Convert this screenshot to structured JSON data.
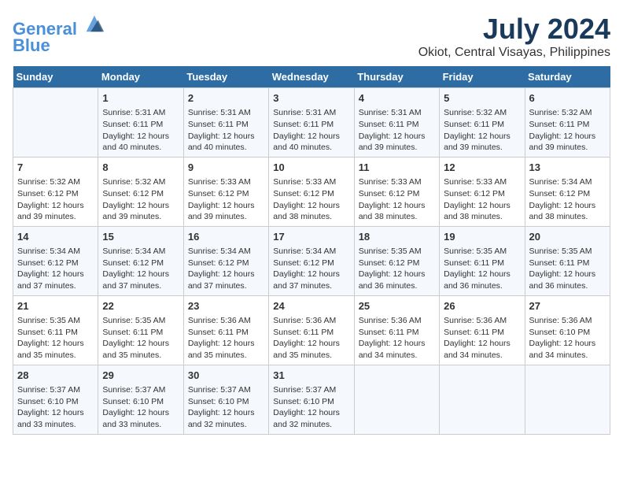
{
  "header": {
    "logo_line1": "General",
    "logo_line2": "Blue",
    "title": "July 2024",
    "subtitle": "Okiot, Central Visayas, Philippines"
  },
  "calendar": {
    "days_of_week": [
      "Sunday",
      "Monday",
      "Tuesday",
      "Wednesday",
      "Thursday",
      "Friday",
      "Saturday"
    ],
    "weeks": [
      [
        {
          "day": "",
          "info": ""
        },
        {
          "day": "1",
          "info": "Sunrise: 5:31 AM\nSunset: 6:11 PM\nDaylight: 12 hours\nand 40 minutes."
        },
        {
          "day": "2",
          "info": "Sunrise: 5:31 AM\nSunset: 6:11 PM\nDaylight: 12 hours\nand 40 minutes."
        },
        {
          "day": "3",
          "info": "Sunrise: 5:31 AM\nSunset: 6:11 PM\nDaylight: 12 hours\nand 40 minutes."
        },
        {
          "day": "4",
          "info": "Sunrise: 5:31 AM\nSunset: 6:11 PM\nDaylight: 12 hours\nand 39 minutes."
        },
        {
          "day": "5",
          "info": "Sunrise: 5:32 AM\nSunset: 6:11 PM\nDaylight: 12 hours\nand 39 minutes."
        },
        {
          "day": "6",
          "info": "Sunrise: 5:32 AM\nSunset: 6:11 PM\nDaylight: 12 hours\nand 39 minutes."
        }
      ],
      [
        {
          "day": "7",
          "info": "Sunrise: 5:32 AM\nSunset: 6:12 PM\nDaylight: 12 hours\nand 39 minutes."
        },
        {
          "day": "8",
          "info": "Sunrise: 5:32 AM\nSunset: 6:12 PM\nDaylight: 12 hours\nand 39 minutes."
        },
        {
          "day": "9",
          "info": "Sunrise: 5:33 AM\nSunset: 6:12 PM\nDaylight: 12 hours\nand 39 minutes."
        },
        {
          "day": "10",
          "info": "Sunrise: 5:33 AM\nSunset: 6:12 PM\nDaylight: 12 hours\nand 38 minutes."
        },
        {
          "day": "11",
          "info": "Sunrise: 5:33 AM\nSunset: 6:12 PM\nDaylight: 12 hours\nand 38 minutes."
        },
        {
          "day": "12",
          "info": "Sunrise: 5:33 AM\nSunset: 6:12 PM\nDaylight: 12 hours\nand 38 minutes."
        },
        {
          "day": "13",
          "info": "Sunrise: 5:34 AM\nSunset: 6:12 PM\nDaylight: 12 hours\nand 38 minutes."
        }
      ],
      [
        {
          "day": "14",
          "info": "Sunrise: 5:34 AM\nSunset: 6:12 PM\nDaylight: 12 hours\nand 37 minutes."
        },
        {
          "day": "15",
          "info": "Sunrise: 5:34 AM\nSunset: 6:12 PM\nDaylight: 12 hours\nand 37 minutes."
        },
        {
          "day": "16",
          "info": "Sunrise: 5:34 AM\nSunset: 6:12 PM\nDaylight: 12 hours\nand 37 minutes."
        },
        {
          "day": "17",
          "info": "Sunrise: 5:34 AM\nSunset: 6:12 PM\nDaylight: 12 hours\nand 37 minutes."
        },
        {
          "day": "18",
          "info": "Sunrise: 5:35 AM\nSunset: 6:12 PM\nDaylight: 12 hours\nand 36 minutes."
        },
        {
          "day": "19",
          "info": "Sunrise: 5:35 AM\nSunset: 6:11 PM\nDaylight: 12 hours\nand 36 minutes."
        },
        {
          "day": "20",
          "info": "Sunrise: 5:35 AM\nSunset: 6:11 PM\nDaylight: 12 hours\nand 36 minutes."
        }
      ],
      [
        {
          "day": "21",
          "info": "Sunrise: 5:35 AM\nSunset: 6:11 PM\nDaylight: 12 hours\nand 35 minutes."
        },
        {
          "day": "22",
          "info": "Sunrise: 5:35 AM\nSunset: 6:11 PM\nDaylight: 12 hours\nand 35 minutes."
        },
        {
          "day": "23",
          "info": "Sunrise: 5:36 AM\nSunset: 6:11 PM\nDaylight: 12 hours\nand 35 minutes."
        },
        {
          "day": "24",
          "info": "Sunrise: 5:36 AM\nSunset: 6:11 PM\nDaylight: 12 hours\nand 35 minutes."
        },
        {
          "day": "25",
          "info": "Sunrise: 5:36 AM\nSunset: 6:11 PM\nDaylight: 12 hours\nand 34 minutes."
        },
        {
          "day": "26",
          "info": "Sunrise: 5:36 AM\nSunset: 6:11 PM\nDaylight: 12 hours\nand 34 minutes."
        },
        {
          "day": "27",
          "info": "Sunrise: 5:36 AM\nSunset: 6:10 PM\nDaylight: 12 hours\nand 34 minutes."
        }
      ],
      [
        {
          "day": "28",
          "info": "Sunrise: 5:37 AM\nSunset: 6:10 PM\nDaylight: 12 hours\nand 33 minutes."
        },
        {
          "day": "29",
          "info": "Sunrise: 5:37 AM\nSunset: 6:10 PM\nDaylight: 12 hours\nand 33 minutes."
        },
        {
          "day": "30",
          "info": "Sunrise: 5:37 AM\nSunset: 6:10 PM\nDaylight: 12 hours\nand 32 minutes."
        },
        {
          "day": "31",
          "info": "Sunrise: 5:37 AM\nSunset: 6:10 PM\nDaylight: 12 hours\nand 32 minutes."
        },
        {
          "day": "",
          "info": ""
        },
        {
          "day": "",
          "info": ""
        },
        {
          "day": "",
          "info": ""
        }
      ]
    ]
  }
}
